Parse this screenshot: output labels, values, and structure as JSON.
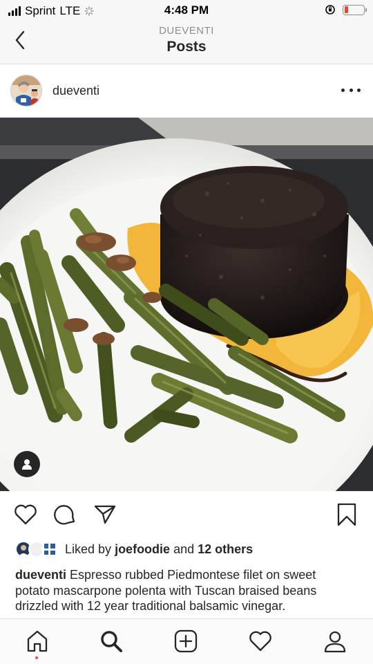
{
  "status_bar": {
    "carrier": "Sprint",
    "network": "LTE",
    "time": "4:48 PM",
    "battery_level": 0.2,
    "battery_color": "#ff3b30"
  },
  "nav": {
    "subtitle": "DUEVENTI",
    "title": "Posts",
    "back_icon": "chevron-left-icon"
  },
  "post": {
    "username": "dueventi",
    "more_icon": "more-horizontal-icon",
    "image_description_icon": "person-tag-icon"
  },
  "actions": {
    "like_icon": "heart-outline-icon",
    "comment_icon": "comment-icon",
    "share_icon": "paper-plane-icon",
    "save_icon": "bookmark-icon"
  },
  "likes": {
    "prefix": "Liked by",
    "user": "joefoodie",
    "connector": "and",
    "others": "12 others"
  },
  "caption": {
    "username": "dueventi",
    "text": "Espresso rubbed Piedmontese filet on sweet potato mascarpone polenta with Tuscan braised beans drizzled with 12 year  traditional balsamic vinegar."
  },
  "tabbar": {
    "items": [
      "home-icon",
      "search-icon",
      "new-post-icon",
      "activity-icon",
      "profile-icon"
    ],
    "notification_color": "#ed4956"
  }
}
